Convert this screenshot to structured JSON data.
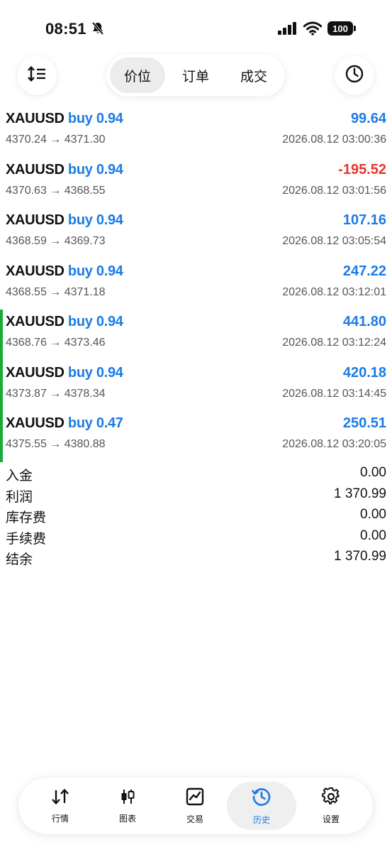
{
  "status": {
    "time": "08:51",
    "battery": "100"
  },
  "tabs": [
    {
      "label": "价位",
      "active": true
    },
    {
      "label": "订单",
      "active": false
    },
    {
      "label": "成交",
      "active": false
    }
  ],
  "colors": {
    "accent": "#1b7be6",
    "loss": "#e8352b",
    "marker": "#1aaa3a"
  },
  "deals": [
    {
      "symbol": "XAUUSD",
      "side": "buy",
      "volume": "0.94",
      "profit": "99.64",
      "profit_color": "#1b7be6",
      "prices": "4370.24 → 4371.30",
      "time": "2026.08.12 03:00:36",
      "marked": false
    },
    {
      "symbol": "XAUUSD",
      "side": "buy",
      "volume": "0.94",
      "profit": "-195.52",
      "profit_color": "#e8352b",
      "prices": "4370.63 → 4368.55",
      "time": "2026.08.12 03:01:56",
      "marked": false
    },
    {
      "symbol": "XAUUSD",
      "side": "buy",
      "volume": "0.94",
      "profit": "107.16",
      "profit_color": "#1b7be6",
      "prices": "4368.59 → 4369.73",
      "time": "2026.08.12 03:05:54",
      "marked": false
    },
    {
      "symbol": "XAUUSD",
      "side": "buy",
      "volume": "0.94",
      "profit": "247.22",
      "profit_color": "#1b7be6",
      "prices": "4368.55 → 4371.18",
      "time": "2026.08.12 03:12:01",
      "marked": false
    },
    {
      "symbol": "XAUUSD",
      "side": "buy",
      "volume": "0.94",
      "profit": "441.80",
      "profit_color": "#1b7be6",
      "prices": "4368.76 → 4373.46",
      "time": "2026.08.12 03:12:24",
      "marked": true
    },
    {
      "symbol": "XAUUSD",
      "side": "buy",
      "volume": "0.94",
      "profit": "420.18",
      "profit_color": "#1b7be6",
      "prices": "4373.87 → 4378.34",
      "time": "2026.08.12 03:14:45",
      "marked": true
    },
    {
      "symbol": "XAUUSD",
      "side": "buy",
      "volume": "0.47",
      "profit": "250.51",
      "profit_color": "#1b7be6",
      "prices": "4375.55 → 4380.88",
      "time": "2026.08.12 03:20:05",
      "marked": true
    }
  ],
  "summary": [
    {
      "label": "入金",
      "value": "0.00"
    },
    {
      "label": "利润",
      "value": "1 370.99"
    },
    {
      "label": "库存费",
      "value": "0.00"
    },
    {
      "label": "手续费",
      "value": "0.00"
    },
    {
      "label": "结余",
      "value": "1 370.99"
    }
  ],
  "nav": [
    {
      "label": "行情",
      "icon": "quotes-arrows-icon",
      "active": false
    },
    {
      "label": "图表",
      "icon": "candlestick-icon",
      "active": false
    },
    {
      "label": "交易",
      "icon": "trade-chart-icon",
      "active": false
    },
    {
      "label": "历史",
      "icon": "history-clock-icon",
      "active": true
    },
    {
      "label": "设置",
      "icon": "gear-icon",
      "active": false
    }
  ]
}
